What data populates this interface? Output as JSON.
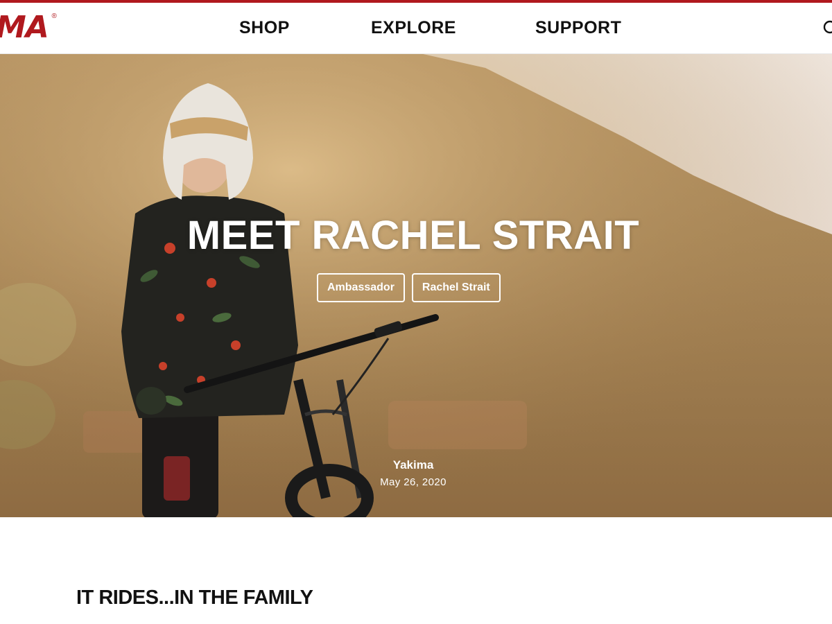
{
  "brand": {
    "logo_text": "MA",
    "registered_mark": "®",
    "accent_color": "#b0191e"
  },
  "nav": {
    "items": [
      {
        "label": "SHOP"
      },
      {
        "label": "EXPLORE"
      },
      {
        "label": "SUPPORT"
      }
    ],
    "search_icon": "search-icon"
  },
  "hero": {
    "title": "MEET RACHEL STRAIT",
    "tags": [
      {
        "label": "Ambassador"
      },
      {
        "label": "Rachel Strait"
      }
    ],
    "author": "Yakima",
    "date": "May 26, 2020",
    "image_subject": "rider in helmet and floral jersey standing with mountain bike at sunset"
  },
  "article": {
    "heading": "IT RIDES...IN THE FAMILY"
  }
}
